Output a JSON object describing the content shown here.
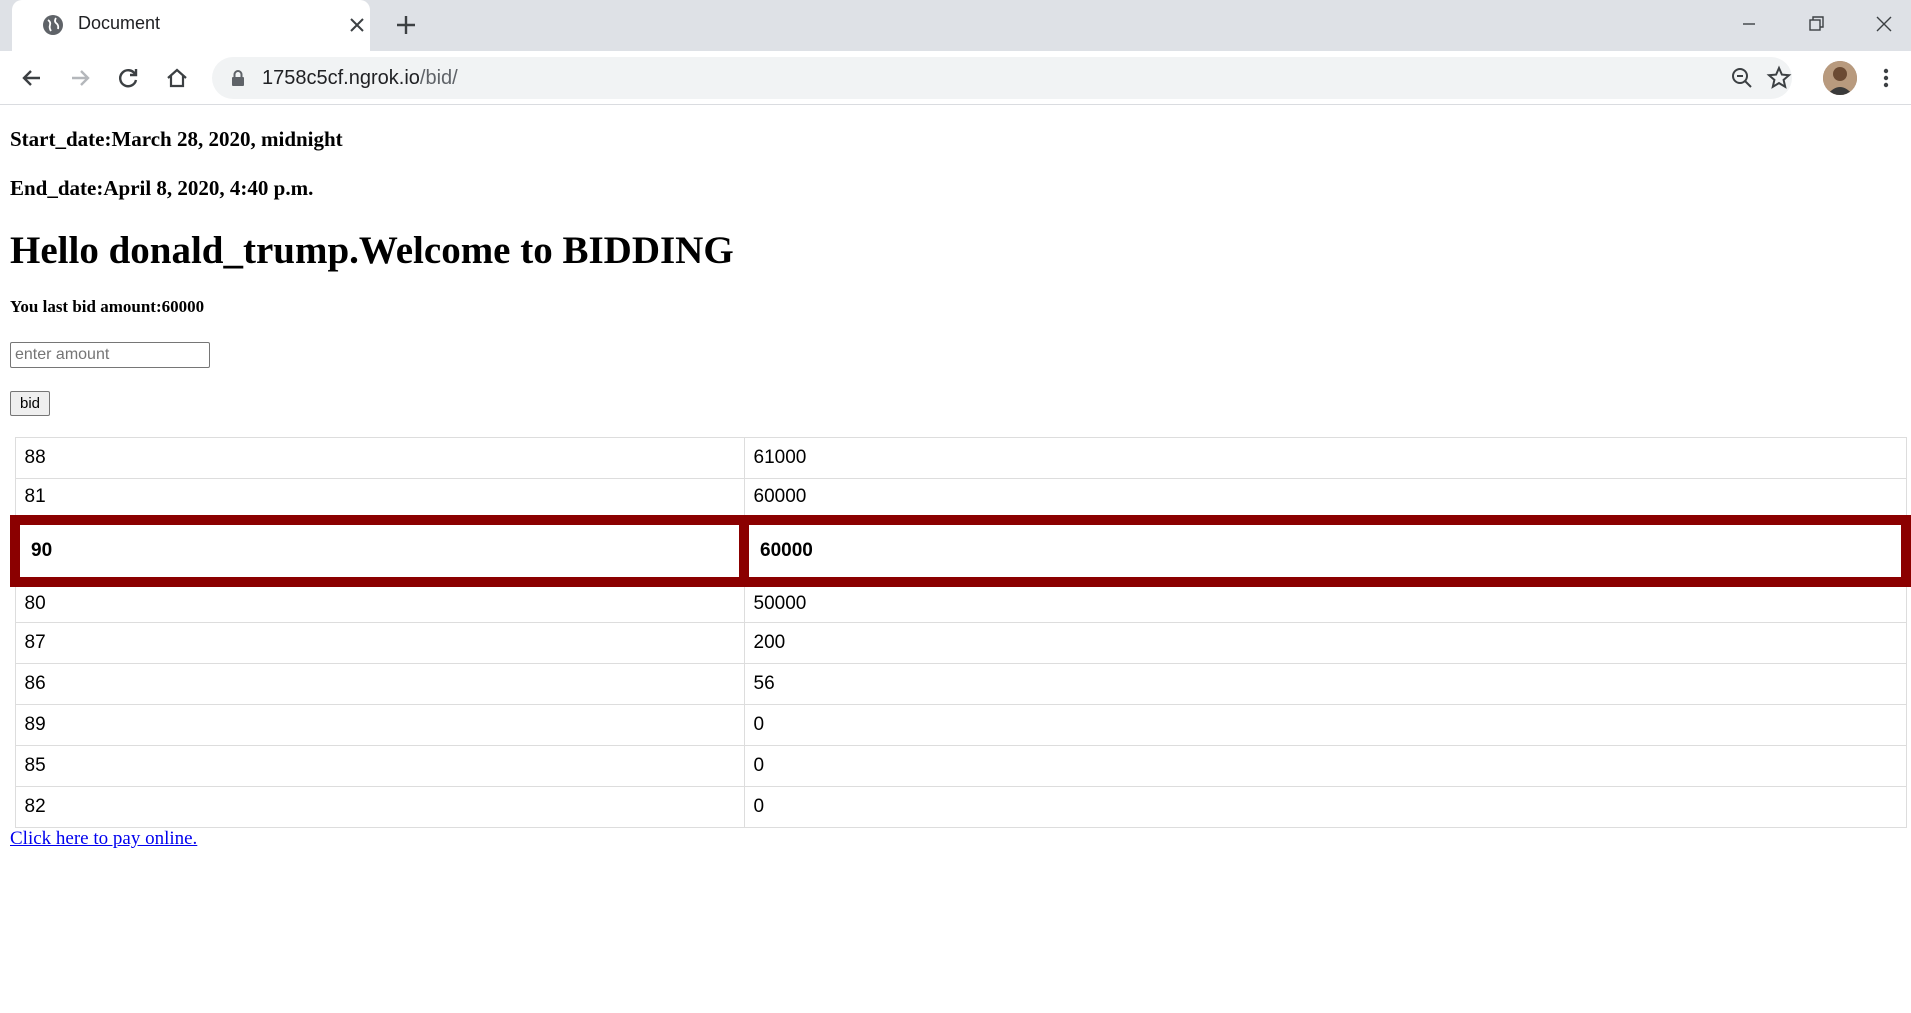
{
  "browser": {
    "tab_title": "Document",
    "url_host": "1758c5cf.ngrok.io",
    "url_path": "/bid/"
  },
  "page": {
    "start_date": "Start_date:March 28, 2020, midnight",
    "end_date": "End_date:April 8, 2020, 4:40 p.m.",
    "greeting": "Hello donald_trump.Welcome to BIDDING",
    "last_bid": "You last bid amount:60000",
    "amount_placeholder": "enter amount",
    "bid_button": "bid",
    "pay_link": "Click here to pay online."
  },
  "bids": [
    {
      "id": "88",
      "amount": "61000"
    },
    {
      "id": "81",
      "amount": "60000"
    },
    {
      "id": "90",
      "amount": "60000",
      "highlighted": true
    },
    {
      "id": "80",
      "amount": "50000"
    },
    {
      "id": "87",
      "amount": "200"
    },
    {
      "id": "86",
      "amount": "56"
    },
    {
      "id": "89",
      "amount": "0"
    },
    {
      "id": "85",
      "amount": "0"
    },
    {
      "id": "82",
      "amount": "0"
    }
  ],
  "colors": {
    "highlight_border": "#8b0000",
    "link": "#0000ee"
  }
}
